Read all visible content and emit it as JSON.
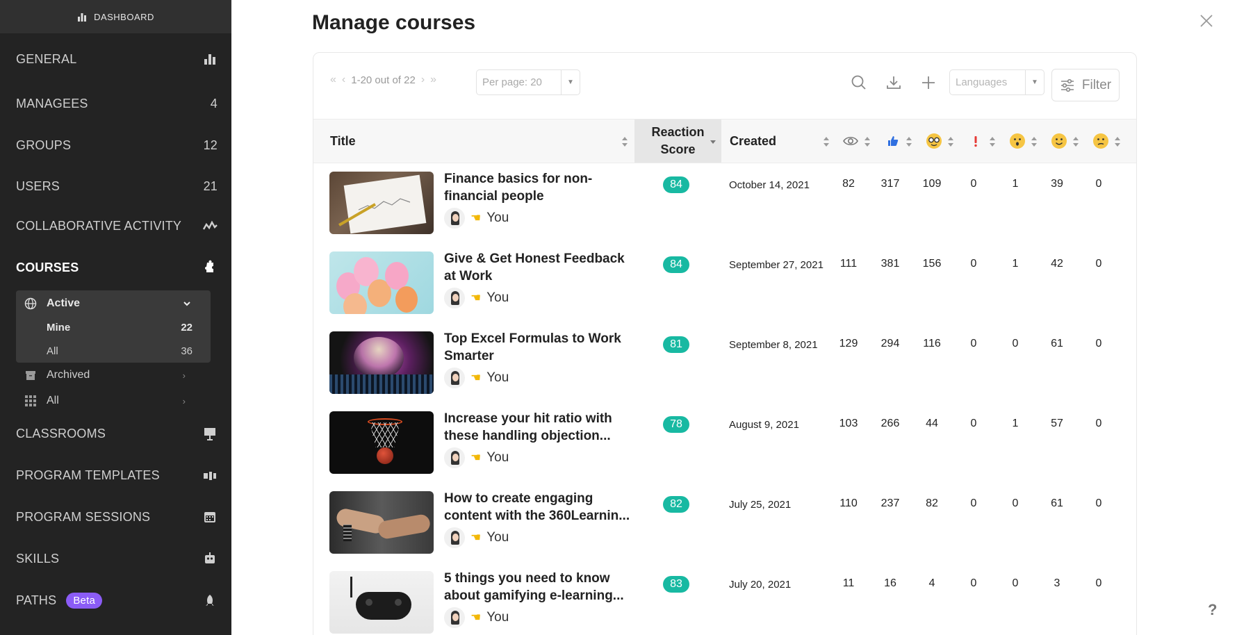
{
  "sidebar": {
    "dashboard_label": "DASHBOARD",
    "items": [
      {
        "label": "GENERAL",
        "count": "",
        "icon": "bar-chart-icon"
      },
      {
        "label": "MANAGEES",
        "count": "4",
        "icon": ""
      },
      {
        "label": "GROUPS",
        "count": "12",
        "icon": ""
      },
      {
        "label": "USERS",
        "count": "21",
        "icon": ""
      },
      {
        "label": "COLLABORATIVE ACTIVITY",
        "count": "",
        "icon": "activity-icon"
      },
      {
        "label": "COURSES",
        "count": "",
        "icon": "puzzle-icon"
      },
      {
        "label": "CLASSROOMS",
        "count": "",
        "icon": "presentation-icon"
      },
      {
        "label": "PROGRAM TEMPLATES",
        "count": "",
        "icon": "template-icon"
      },
      {
        "label": "PROGRAM SESSIONS",
        "count": "",
        "icon": "calendar-icon"
      },
      {
        "label": "SKILLS",
        "count": "",
        "icon": "robot-icon"
      },
      {
        "label": "PATHS",
        "count": "",
        "icon": "rocket-icon",
        "badge": "Beta"
      }
    ],
    "courses_sub": {
      "active_label": "Active",
      "mine_label": "Mine",
      "mine_count": "22",
      "all_label": "All",
      "all_count": "36",
      "archived_label": "Archived",
      "all_label2": "All"
    }
  },
  "main": {
    "title": "Manage courses",
    "pager_text": "1-20 out of 22",
    "per_page": "Per page: 20",
    "languages_placeholder": "Languages",
    "filter_label": "Filter",
    "columns": {
      "title": "Title",
      "reaction_line1": "Reaction",
      "reaction_line2": "Score",
      "created": "Created"
    },
    "author_label": "You",
    "rows": [
      {
        "title": "Finance basics for non-financial people",
        "score": "84",
        "created": "October 14, 2021",
        "views": "82",
        "likes": "317",
        "nerd": "109",
        "alert": "0",
        "neutral": "1",
        "happy": "39",
        "sad": "0"
      },
      {
        "title": "Give & Get Honest Feedback at Work",
        "score": "84",
        "created": "September 27, 2021",
        "views": "111",
        "likes": "381",
        "nerd": "156",
        "alert": "0",
        "neutral": "1",
        "happy": "42",
        "sad": "0"
      },
      {
        "title": "Top Excel Formulas to Work Smarter",
        "score": "81",
        "created": "September 8, 2021",
        "views": "129",
        "likes": "294",
        "nerd": "116",
        "alert": "0",
        "neutral": "0",
        "happy": "61",
        "sad": "0"
      },
      {
        "title": "Increase your hit ratio with these handling objection...",
        "score": "78",
        "created": "August 9, 2021",
        "views": "103",
        "likes": "266",
        "nerd": "44",
        "alert": "0",
        "neutral": "1",
        "happy": "57",
        "sad": "0"
      },
      {
        "title": "How to create engaging content with the 360Learnin...",
        "score": "82",
        "created": "July 25, 2021",
        "views": "110",
        "likes": "237",
        "nerd": "82",
        "alert": "0",
        "neutral": "0",
        "happy": "61",
        "sad": "0"
      },
      {
        "title": "5 things you need to know about gamifying e-learning...",
        "score": "83",
        "created": "July 20, 2021",
        "views": "11",
        "likes": "16",
        "nerd": "4",
        "alert": "0",
        "neutral": "0",
        "happy": "3",
        "sad": "0"
      }
    ],
    "help_label": "?"
  },
  "colors": {
    "sidebar_bg": "#232323",
    "score_badge": "#18b9a2",
    "beta_badge": "#8b5cf6"
  }
}
